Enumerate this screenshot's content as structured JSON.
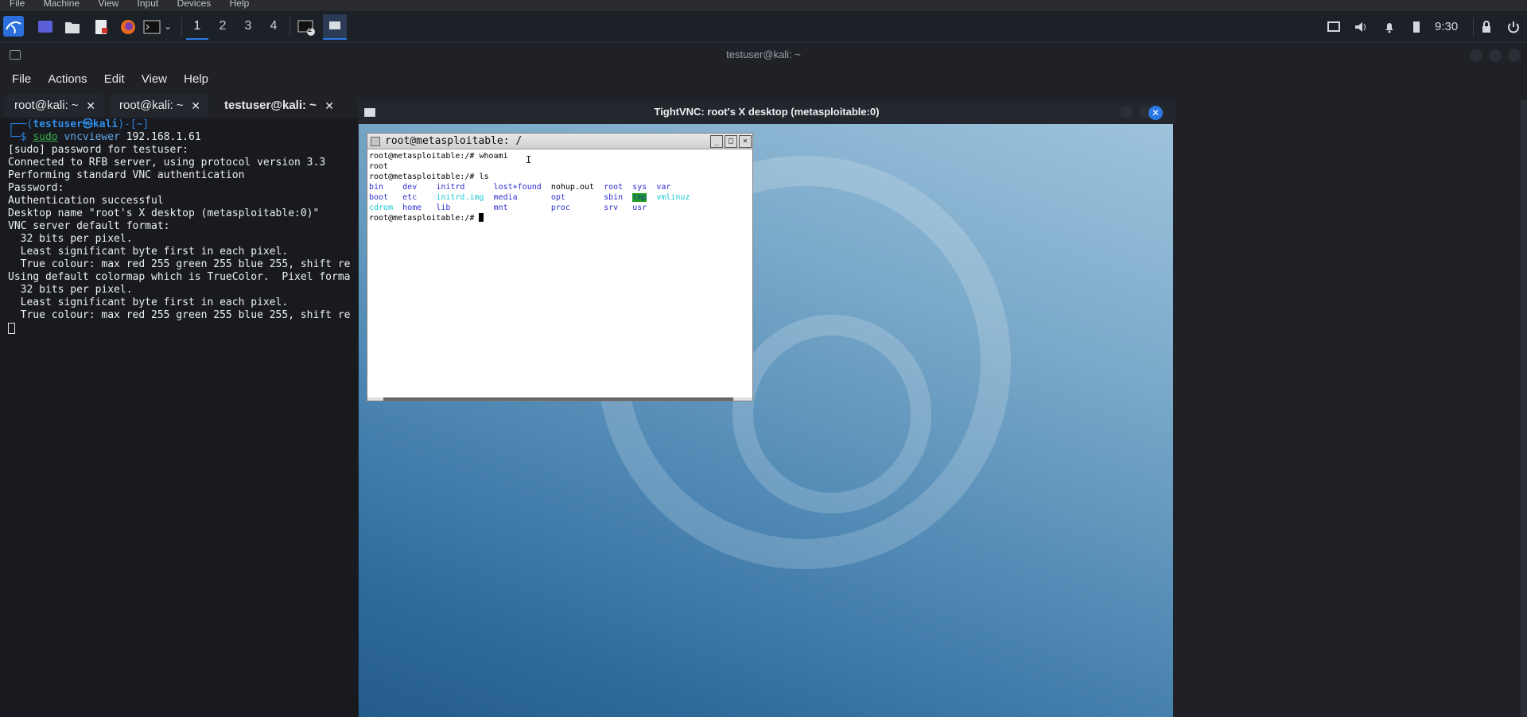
{
  "vbox_menu": [
    "File",
    "Machine",
    "View",
    "Input",
    "Devices",
    "Help"
  ],
  "panel": {
    "workspaces": [
      "1",
      "2",
      "3",
      "4"
    ],
    "active_workspace": "1",
    "clock": "9:30",
    "terminal_badge": "2"
  },
  "terminal": {
    "window_title": "testuser@kali: ~",
    "menu": [
      "File",
      "Actions",
      "Edit",
      "View",
      "Help"
    ],
    "tabs": [
      {
        "label": "root@kali: ~",
        "close": "✕"
      },
      {
        "label": "root@kali: ~",
        "close": "✕"
      },
      {
        "label": "testuser@kali: ~",
        "close": "✕"
      }
    ],
    "prompt_open": "┌──(",
    "prompt_user": "testuser㉿kali",
    "prompt_close": ")-[~]",
    "prompt_dollar": "└─$ ",
    "cmd_sudo": "sudo",
    "cmd_rest": " vncviewer",
    "cmd_arg": " 192.168.1.61",
    "output": [
      "[sudo] password for testuser:",
      "Connected to RFB server, using protocol version 3.3",
      "Performing standard VNC authentication",
      "Password:",
      "Authentication successful",
      "Desktop name \"root's X desktop (metasploitable:0)\"",
      "VNC server default format:",
      "  32 bits per pixel.",
      "  Least significant byte first in each pixel.",
      "  True colour: max red 255 green 255 blue 255, shift re",
      "Using default colormap which is TrueColor.  Pixel forma",
      "  32 bits per pixel.",
      "  Least significant byte first in each pixel.",
      "  True colour: max red 255 green 255 blue 255, shift re"
    ]
  },
  "vnc": {
    "title": "TightVNC: root's X desktop (metasploitable:0)",
    "close": "✕"
  },
  "xterm": {
    "title": "root@metasploitable: /",
    "cmd1": "root@metasploitable:/# whoami",
    "out1": "root",
    "cmd2": "root@metasploitable:/# ls",
    "ls_rows": [
      [
        "bin",
        "dev",
        "initrd",
        "lost+found",
        "nohup.out",
        "root",
        "sys",
        "var"
      ],
      [
        "boot",
        "etc",
        "initrd.img",
        "media",
        "opt",
        "sbin",
        "tmp",
        "vmlinuz"
      ],
      [
        "cdrom",
        "home",
        "lib",
        "mnt",
        "proc",
        "srv",
        "usr"
      ]
    ],
    "prompt3": "root@metasploitable:/# "
  },
  "colors": {
    "accent": "#2a78e4",
    "ls_dir": "#2f2fd0",
    "ls_link": "#18c8d8",
    "tmp_bg": "#22a022"
  }
}
